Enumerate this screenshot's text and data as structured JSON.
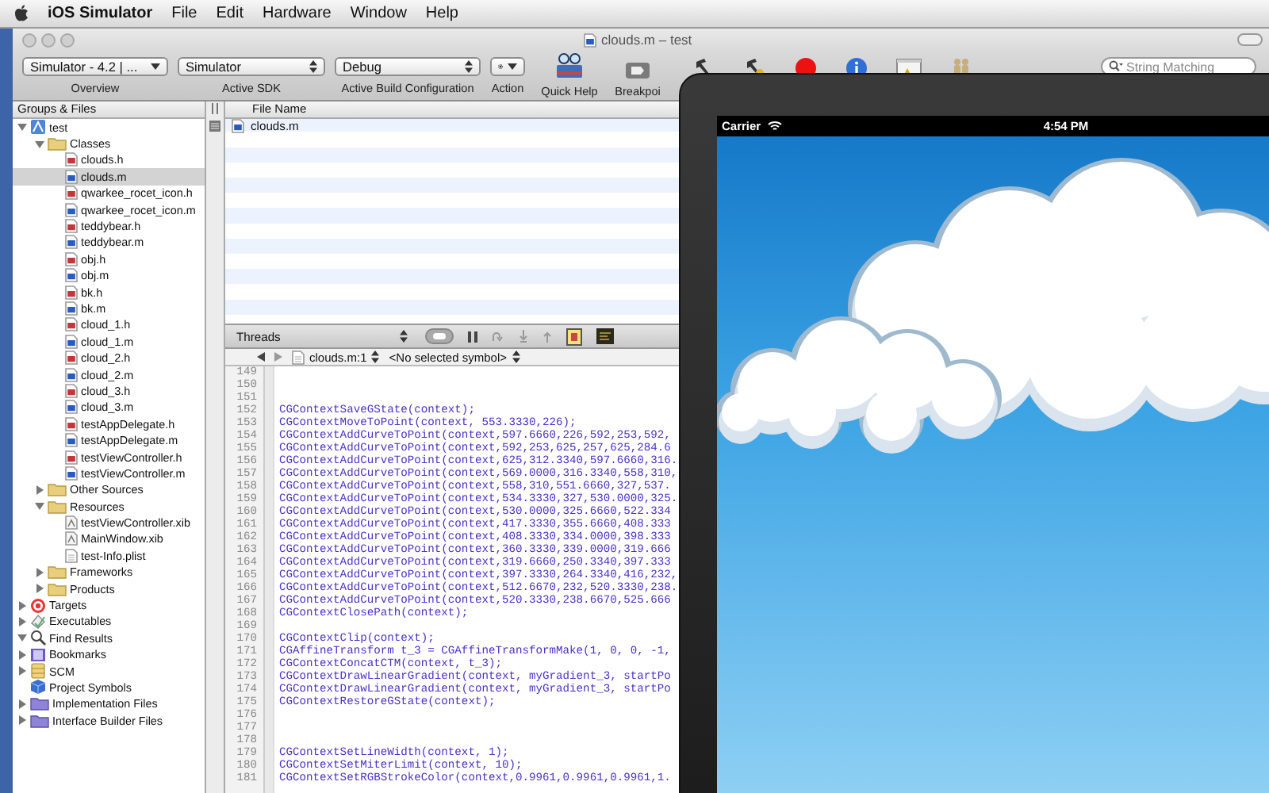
{
  "menu_bar": {
    "app_name": "iOS Simulator",
    "items": [
      "File",
      "Edit",
      "Hardware",
      "Window",
      "Help"
    ]
  },
  "window": {
    "title": "clouds.m – test"
  },
  "toolbar": {
    "items": [
      {
        "kind": "popup",
        "value": "Simulator - 4.2 | ...",
        "label": "Overview"
      },
      {
        "kind": "stepper-popup",
        "value": "Simulator",
        "label": "Active SDK"
      },
      {
        "kind": "stepper-popup",
        "value": "Debug",
        "label": "Active Build Configuration"
      },
      {
        "kind": "gear",
        "label": "Action"
      },
      {
        "kind": "quick-help",
        "label": "Quick Help"
      },
      {
        "kind": "breakpoints",
        "label": "Breakpoi"
      }
    ],
    "search": {
      "placeholder": "String Matching"
    }
  },
  "sidebar": {
    "header": "Groups & Files",
    "items": [
      {
        "label": "test",
        "kind": "project",
        "expanded": true,
        "selected": false,
        "children": [
          {
            "label": "Classes",
            "kind": "group",
            "expanded": true,
            "selected": false,
            "children": [
              {
                "label": "clouds.h",
                "kind": "header",
                "selected": false
              },
              {
                "label": "clouds.m",
                "kind": "source",
                "selected": true
              },
              {
                "label": "qwarkee_rocet_icon.h",
                "kind": "header",
                "selected": false
              },
              {
                "label": "qwarkee_rocet_icon.m",
                "kind": "source",
                "selected": false
              },
              {
                "label": "teddybear.h",
                "kind": "header",
                "selected": false
              },
              {
                "label": "teddybear.m",
                "kind": "source",
                "selected": false
              },
              {
                "label": "obj.h",
                "kind": "header",
                "selected": false
              },
              {
                "label": "obj.m",
                "kind": "source",
                "selected": false
              },
              {
                "label": "bk.h",
                "kind": "header",
                "selected": false
              },
              {
                "label": "bk.m",
                "kind": "source",
                "selected": false
              },
              {
                "label": "cloud_1.h",
                "kind": "header",
                "selected": false
              },
              {
                "label": "cloud_1.m",
                "kind": "source",
                "selected": false
              },
              {
                "label": "cloud_2.h",
                "kind": "header",
                "selected": false
              },
              {
                "label": "cloud_2.m",
                "kind": "source",
                "selected": false
              },
              {
                "label": "cloud_3.h",
                "kind": "header",
                "selected": false
              },
              {
                "label": "cloud_3.m",
                "kind": "source",
                "selected": false
              },
              {
                "label": "testAppDelegate.h",
                "kind": "header",
                "selected": false
              },
              {
                "label": "testAppDelegate.m",
                "kind": "source",
                "selected": false
              },
              {
                "label": "testViewController.h",
                "kind": "header",
                "selected": false
              },
              {
                "label": "testViewController.m",
                "kind": "source",
                "selected": false
              }
            ]
          },
          {
            "label": "Other Sources",
            "kind": "group",
            "expanded": false,
            "selected": false
          },
          {
            "label": "Resources",
            "kind": "group",
            "expanded": true,
            "selected": false,
            "children": [
              {
                "label": "testViewController.xib",
                "kind": "xib",
                "selected": false
              },
              {
                "label": "MainWindow.xib",
                "kind": "xib",
                "selected": false
              },
              {
                "label": "test-Info.plist",
                "kind": "plist",
                "selected": false
              }
            ]
          },
          {
            "label": "Frameworks",
            "kind": "group",
            "expanded": false,
            "selected": false
          },
          {
            "label": "Products",
            "kind": "group",
            "expanded": false,
            "selected": false
          }
        ]
      },
      {
        "label": "Targets",
        "kind": "targets",
        "expanded": false,
        "selected": false
      },
      {
        "label": "Executables",
        "kind": "executables",
        "expanded": false,
        "selected": false
      },
      {
        "label": "Find Results",
        "kind": "find",
        "expanded": true,
        "selected": false
      },
      {
        "label": "Bookmarks",
        "kind": "bookmarks",
        "expanded": false,
        "selected": false
      },
      {
        "label": "SCM",
        "kind": "scm",
        "expanded": false,
        "selected": false
      },
      {
        "label": "Project Symbols",
        "kind": "symbols",
        "selected": false
      },
      {
        "label": "Implementation Files",
        "kind": "smart-group",
        "expanded": false,
        "selected": false
      },
      {
        "label": "Interface Builder Files",
        "kind": "smart-group",
        "expanded": false,
        "selected": false
      }
    ]
  },
  "file_list": {
    "column": "File Name",
    "rows": [
      {
        "name": "clouds.m",
        "selected": false
      }
    ]
  },
  "debug_bar": {
    "threads": "Threads"
  },
  "navigator": {
    "file": "clouds.m:1",
    "symbol": "<No selected symbol>"
  },
  "editor": {
    "lines": [
      {
        "number": "149"
      },
      {
        "number": "150"
      },
      {
        "number": "151"
      },
      {
        "number": "152",
        "text": "CGContextSaveGState(context);"
      },
      {
        "number": "153",
        "text": "CGContextMoveToPoint(context, 553.3330,226);"
      },
      {
        "number": "154",
        "text": "CGContextAddCurveToPoint(context,597.6660,226,592,253,592,"
      },
      {
        "number": "155",
        "text": "CGContextAddCurveToPoint(context,592,253,625,257,625,284.6"
      },
      {
        "number": "156",
        "text": "CGContextAddCurveToPoint(context,625,312.3340,597.6660,316."
      },
      {
        "number": "157",
        "text": "CGContextAddCurveToPoint(context,569.0000,316.3340,558,310,"
      },
      {
        "number": "158",
        "text": "CGContextAddCurveToPoint(context,558,310,551.6660,327,537."
      },
      {
        "number": "159",
        "text": "CGContextAddCurveToPoint(context,534.3330,327,530.0000,325."
      },
      {
        "number": "160",
        "text": "CGContextAddCurveToPoint(context,530.0000,325.6660,522.334"
      },
      {
        "number": "161",
        "text": "CGContextAddCurveToPoint(context,417.3330,355.6660,408.333"
      },
      {
        "number": "162",
        "text": "CGContextAddCurveToPoint(context,408.3330,334.0000,398.333"
      },
      {
        "number": "163",
        "text": "CGContextAddCurveToPoint(context,360.3330,339.0000,319.666"
      },
      {
        "number": "164",
        "text": "CGContextAddCurveToPoint(context,319.6660,250.3340,397.333"
      },
      {
        "number": "165",
        "text": "CGContextAddCurveToPoint(context,397.3330,264.3340,416,232,"
      },
      {
        "number": "166",
        "text": "CGContextAddCurveToPoint(context,512.6670,232,520.3330,238."
      },
      {
        "number": "167",
        "text": "CGContextAddCurveToPoint(context,520.3330,238.6670,525.666"
      },
      {
        "number": "168",
        "text": "CGContextClosePath(context);"
      },
      {
        "number": "169"
      },
      {
        "number": "170",
        "text": "CGContextClip(context);"
      },
      {
        "number": "171",
        "text": "CGAffineTransform t_3 = CGAffineTransformMake(1, 0, 0, -1,"
      },
      {
        "number": "172",
        "text": "CGContextConcatCTM(context, t_3);"
      },
      {
        "number": "173",
        "text": "CGContextDrawLinearGradient(context, myGradient_3, startPo"
      },
      {
        "number": "174",
        "text": "CGContextDrawLinearGradient(context, myGradient_3, startPo"
      },
      {
        "number": "175",
        "text": "CGContextRestoreGState(context);"
      },
      {
        "number": "176"
      },
      {
        "number": "177"
      },
      {
        "number": "178"
      },
      {
        "number": "179",
        "text": "CGContextSetLineWidth(context, 1);"
      },
      {
        "number": "180",
        "text": "CGContextSetMiterLimit(context, 10);"
      },
      {
        "number": "181",
        "text": "CGContextSetRGBStrokeColor(context,0.9961,0.9961,0.9961,1."
      }
    ]
  },
  "simulator": {
    "carrier": "Carrier",
    "time": "4:54 PM"
  }
}
